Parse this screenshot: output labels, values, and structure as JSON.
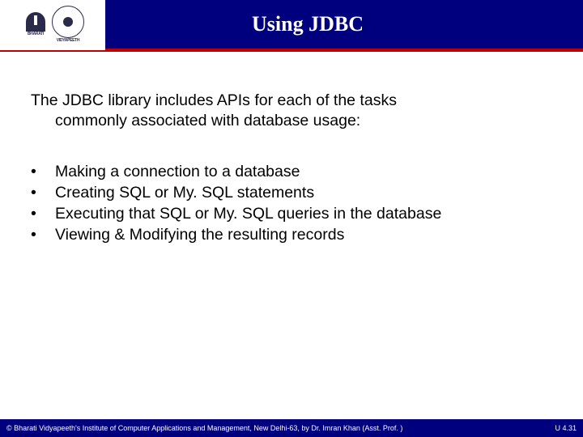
{
  "header": {
    "title": "Using JDBC",
    "logo_text_top": "BHARATI",
    "logo_text_right": "VIDYAPEETH"
  },
  "intro": {
    "line1": "The JDBC library includes APIs for each of the tasks",
    "line2": "commonly associated with database usage:"
  },
  "bullets": [
    "Making a connection to a database",
    "Creating SQL or My. SQL statements",
    "Executing that SQL or My. SQL queries in the database",
    "Viewing & Modifying the resulting records"
  ],
  "footer": {
    "copyright": "© Bharati Vidyapeeth's Institute of Computer Applications and Management, New Delhi-63, by  Dr. Imran Khan (Asst. Prof. )",
    "page": "U 4.31"
  }
}
